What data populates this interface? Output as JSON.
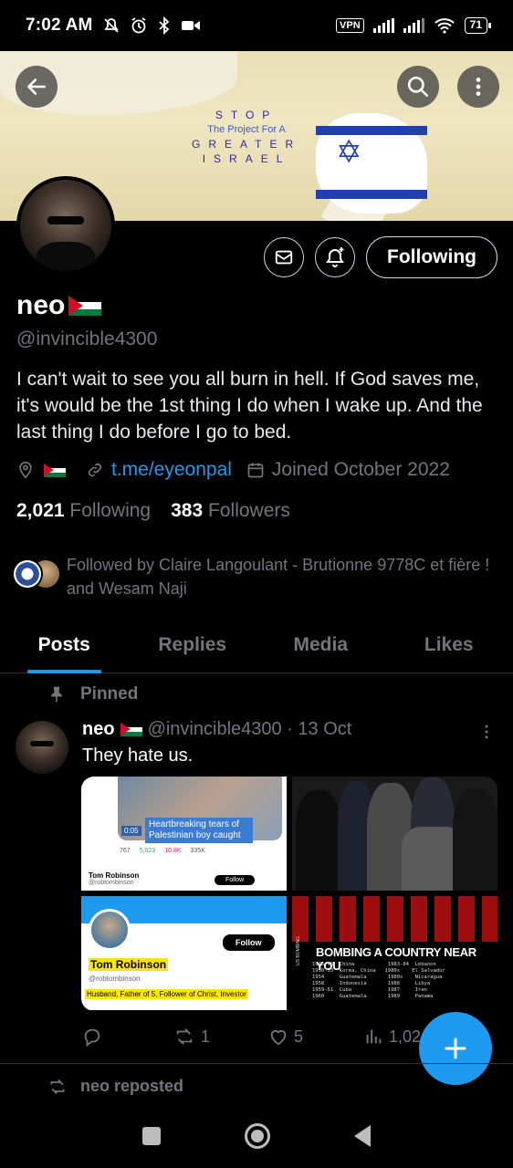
{
  "status_bar": {
    "time": "7:02 AM",
    "vpn": "VPN",
    "battery": "71",
    "icons": [
      "mute-icon",
      "alarm-icon",
      "bluetooth-icon",
      "video-icon",
      "signal-icon",
      "signal-icon",
      "wifi-icon",
      "battery-icon"
    ]
  },
  "banner": {
    "line1": "STOP",
    "line2": "The Project For A",
    "line3": "GREATER",
    "line4": "ISRAEL"
  },
  "profile": {
    "display_name": "neo",
    "handle": "@invincible4300",
    "bio": "I can't wait to see you all burn in hell. If God saves me, it's would be the 1st thing I do when I wake up. And the last thing I do before I go to bed.",
    "link": "t.me/eyeonpal",
    "joined": "Joined October 2022",
    "following_count": "2,021",
    "following_label": "Following",
    "followers_count": "383",
    "followers_label": "Followers",
    "followed_by": "Followed by Claire Langoulant - Brutionne 9778C et fière ! and Wesam Naji",
    "follow_button": "Following"
  },
  "tabs": [
    {
      "label": "Posts",
      "active": true
    },
    {
      "label": "Replies",
      "active": false
    },
    {
      "label": "Media",
      "active": false
    },
    {
      "label": "Likes",
      "active": false
    }
  ],
  "pinned_tweet": {
    "pinned_label": "Pinned",
    "author": "neo",
    "handle_date": "@invincible4300 · 13 Oct",
    "text": "They hate us.",
    "media": {
      "m1_caption": "Heartbreaking tears of Palestinian boy caught",
      "m1_time": "0:05",
      "m1_stats": [
        "767",
        "5,023",
        "10.8K",
        "335K"
      ],
      "m1_user": "Tom Robinson",
      "m1_handle": "@robtombinson",
      "m1_follow": "Follow",
      "m3_follow": "Follow",
      "m3_name": "Tom Robinson",
      "m3_handle": "@robtombinson",
      "m3_bio": "Husband, Father of 5, Follower of Christ, Investor",
      "m4_title": "BOMBING A COUNTRY NEAR YOU",
      "m4_side": "US BOMBING",
      "m4_list": "1945-46  China           1983-84  Lebanon\n1950-53  Korea, China   1980s    El Salvador\n1954     Guatemala       1980s    Nicaragua\n1958     Indonesia       1986     Libya\n1959-61  Cuba            1987     Iran\n1960     Guatemala       1989     Panama"
    },
    "reposts": "1",
    "likes": "5",
    "views": "1,02"
  },
  "next_item": {
    "reposted_label": "neo reposted"
  },
  "colors": {
    "accent": "#1d9bf0",
    "muted": "#71767b",
    "background": "#000000"
  }
}
